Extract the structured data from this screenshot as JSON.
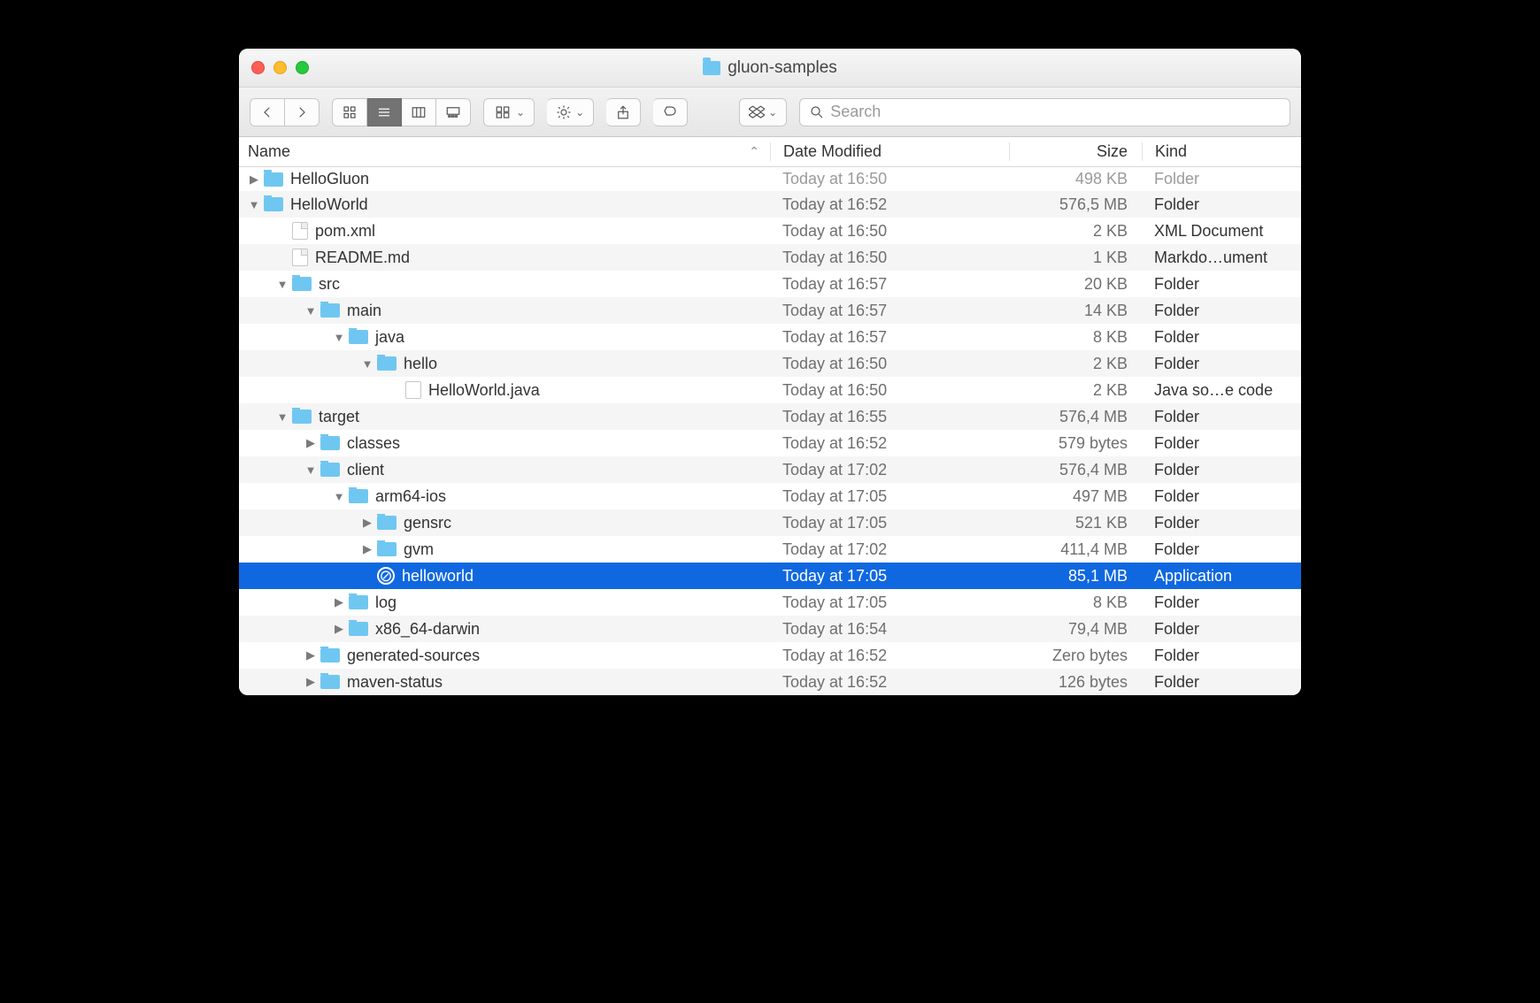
{
  "window": {
    "title": "gluon-samples"
  },
  "search": {
    "placeholder": "Search"
  },
  "columns": {
    "name": "Name",
    "date": "Date Modified",
    "size": "Size",
    "kind": "Kind"
  },
  "rows": [
    {
      "depth": 0,
      "arrow": "right",
      "icon": "folder",
      "name": "HelloGluon",
      "date": "Today at 16:50",
      "size": "498 KB",
      "kind": "Folder",
      "alt": false,
      "cut": true
    },
    {
      "depth": 0,
      "arrow": "down",
      "icon": "folder",
      "name": "HelloWorld",
      "date": "Today at 16:52",
      "size": "576,5 MB",
      "kind": "Folder",
      "alt": true
    },
    {
      "depth": 1,
      "arrow": "",
      "icon": "file",
      "name": "pom.xml",
      "date": "Today at 16:50",
      "size": "2 KB",
      "kind": "XML Document",
      "alt": false
    },
    {
      "depth": 1,
      "arrow": "",
      "icon": "file",
      "name": "README.md",
      "date": "Today at 16:50",
      "size": "1 KB",
      "kind": "Markdo…ument",
      "alt": true
    },
    {
      "depth": 1,
      "arrow": "down",
      "icon": "folder",
      "name": "src",
      "date": "Today at 16:57",
      "size": "20 KB",
      "kind": "Folder",
      "alt": false
    },
    {
      "depth": 2,
      "arrow": "down",
      "icon": "folder",
      "name": "main",
      "date": "Today at 16:57",
      "size": "14 KB",
      "kind": "Folder",
      "alt": true
    },
    {
      "depth": 3,
      "arrow": "down",
      "icon": "folder",
      "name": "java",
      "date": "Today at 16:57",
      "size": "8 KB",
      "kind": "Folder",
      "alt": false
    },
    {
      "depth": 4,
      "arrow": "down",
      "icon": "folder",
      "name": "hello",
      "date": "Today at 16:50",
      "size": "2 KB",
      "kind": "Folder",
      "alt": true
    },
    {
      "depth": 5,
      "arrow": "",
      "icon": "filegray",
      "name": "HelloWorld.java",
      "date": "Today at 16:50",
      "size": "2 KB",
      "kind": "Java so…e code",
      "alt": false
    },
    {
      "depth": 1,
      "arrow": "down",
      "icon": "folder",
      "name": "target",
      "date": "Today at 16:55",
      "size": "576,4 MB",
      "kind": "Folder",
      "alt": true
    },
    {
      "depth": 2,
      "arrow": "right",
      "icon": "folder",
      "name": "classes",
      "date": "Today at 16:52",
      "size": "579 bytes",
      "kind": "Folder",
      "alt": false
    },
    {
      "depth": 2,
      "arrow": "down",
      "icon": "folder",
      "name": "client",
      "date": "Today at 17:02",
      "size": "576,4 MB",
      "kind": "Folder",
      "alt": true
    },
    {
      "depth": 3,
      "arrow": "down",
      "icon": "folder",
      "name": "arm64-ios",
      "date": "Today at 17:05",
      "size": "497 MB",
      "kind": "Folder",
      "alt": false
    },
    {
      "depth": 4,
      "arrow": "right",
      "icon": "folder",
      "name": "gensrc",
      "date": "Today at 17:05",
      "size": "521 KB",
      "kind": "Folder",
      "alt": true
    },
    {
      "depth": 4,
      "arrow": "right",
      "icon": "folder",
      "name": "gvm",
      "date": "Today at 17:02",
      "size": "411,4 MB",
      "kind": "Folder",
      "alt": false
    },
    {
      "depth": 4,
      "arrow": "",
      "icon": "app",
      "name": "helloworld",
      "date": "Today at 17:05",
      "size": "85,1 MB",
      "kind": "Application",
      "alt": true,
      "selected": true
    },
    {
      "depth": 3,
      "arrow": "right",
      "icon": "folder",
      "name": "log",
      "date": "Today at 17:05",
      "size": "8 KB",
      "kind": "Folder",
      "alt": false
    },
    {
      "depth": 3,
      "arrow": "right",
      "icon": "folder",
      "name": "x86_64-darwin",
      "date": "Today at 16:54",
      "size": "79,4 MB",
      "kind": "Folder",
      "alt": true
    },
    {
      "depth": 2,
      "arrow": "right",
      "icon": "folder",
      "name": "generated-sources",
      "date": "Today at 16:52",
      "size": "Zero bytes",
      "kind": "Folder",
      "alt": false
    },
    {
      "depth": 2,
      "arrow": "right",
      "icon": "folder",
      "name": "maven-status",
      "date": "Today at 16:52",
      "size": "126 bytes",
      "kind": "Folder",
      "alt": true
    }
  ]
}
